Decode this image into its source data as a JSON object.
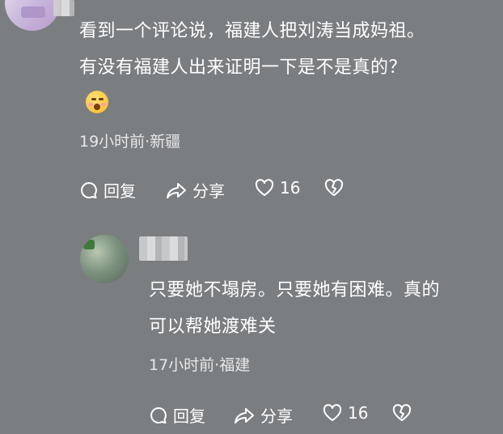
{
  "comment1": {
    "text_line1": "看到一个评论说，福建人把刘涛当成妈祖。",
    "text_line2": "有没有福建人出来证明一下是不是真的？",
    "meta": "19小时前·新疆",
    "actions": {
      "reply": "回复",
      "share": "分享",
      "likes": "16"
    }
  },
  "comment2": {
    "text_line1": "只要她不塌房。只要她有困难。真的",
    "text_line2": "可以帮她渡难关",
    "meta": "17小时前·福建",
    "actions": {
      "reply": "回复",
      "share": "分享",
      "likes": "16"
    }
  },
  "icons": {
    "reply": "comment-bubble-icon",
    "share": "share-arrow-icon",
    "like": "heart-icon",
    "dislike": "broken-heart-icon",
    "emoji": "blushing-face-emoji"
  },
  "colors": {
    "background": "#7b7e81",
    "text": "#ffffff",
    "meta": "#e6e7e8"
  }
}
